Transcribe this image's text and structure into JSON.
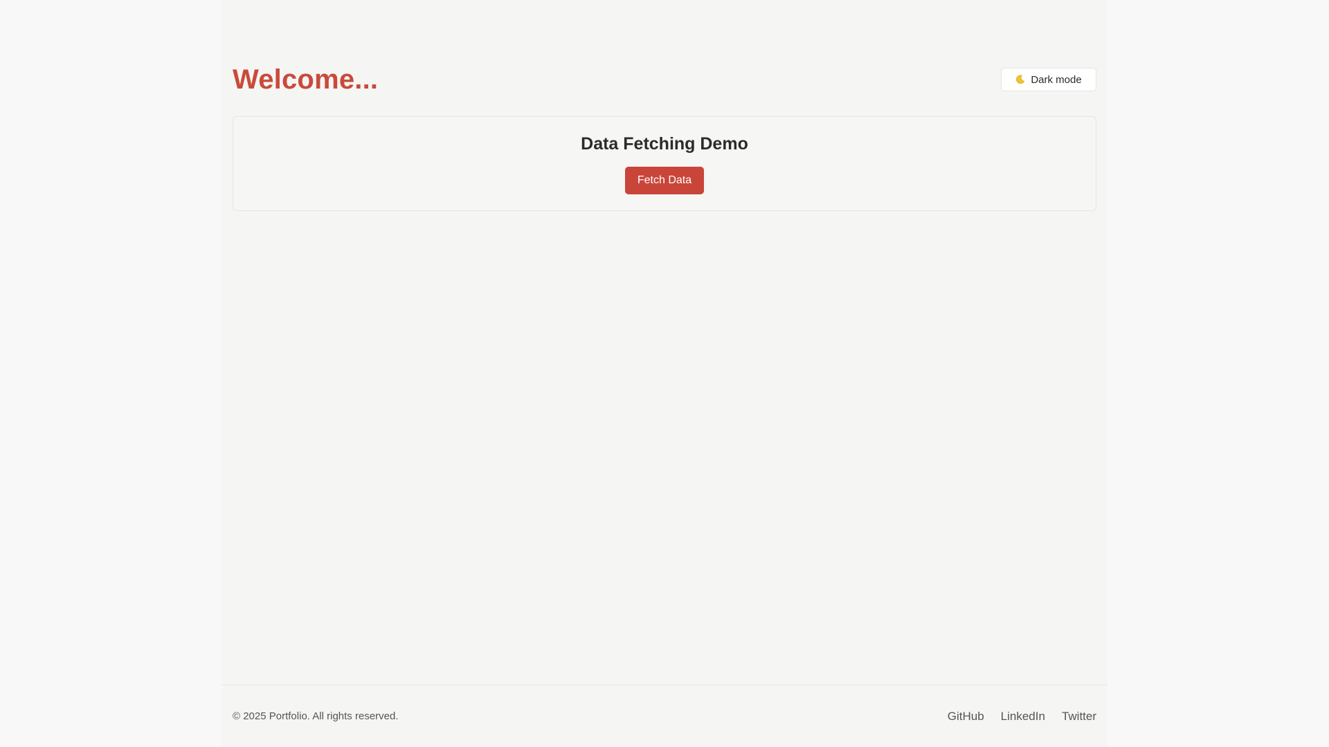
{
  "header": {
    "welcome_text": "Welcome...",
    "dark_mode_label": "Dark mode",
    "dark_mode_icon": "moon-icon"
  },
  "card": {
    "title": "Data Fetching Demo",
    "fetch_button_label": "Fetch Data"
  },
  "footer": {
    "copyright": "© 2025 Portfolio. All rights reserved.",
    "links": [
      {
        "label": "GitHub"
      },
      {
        "label": "LinkedIn"
      },
      {
        "label": "Twitter"
      }
    ]
  },
  "colors": {
    "accent": "#c9453a",
    "page_background": "#f5f5f3",
    "outer_background": "#f8f8f8"
  }
}
